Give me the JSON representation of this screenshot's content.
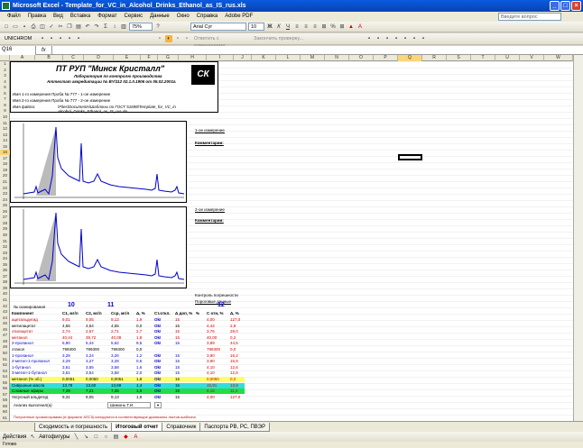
{
  "window": {
    "title": "Microsoft Excel - Template_for_VC_in_Alcohol_Drinks_Ethanol_as_IS_rus.xls"
  },
  "menu": [
    "Файл",
    "Правка",
    "Вид",
    "Вставка",
    "Формат",
    "Сервис",
    "Данные",
    "Окно",
    "Справка",
    "Adobe PDF"
  ],
  "question": {
    "placeholder": "Введите вопрос"
  },
  "toolbar": {
    "zoom": "75%",
    "font": "Arial Cyr",
    "size": "10",
    "unichrom": "UNICHROM",
    "reply": "Ответить с изменениями...",
    "end_review": "Закончить проверку..."
  },
  "formula": {
    "namebox": "Q16",
    "fx": "fx"
  },
  "columns": [
    "A",
    "B",
    "C",
    "D",
    "E",
    "F",
    "G",
    "H",
    "I",
    "J",
    "K",
    "L",
    "M",
    "N",
    "O",
    "P",
    "Q",
    "R",
    "S",
    "T",
    "U",
    "V",
    "W"
  ],
  "header": {
    "company": "ПТ РУП \"Минск Кристалл\"",
    "lab": "Лаборатория по контролю производства",
    "attest": "Аттестат аккредитации № BY/112 02.1.0.1906 от 05.02.2001г.",
    "logo": "СК"
  },
  "meta": {
    "row1": "Имя 1-го измерения Проба № 777 - 1-ое измерение",
    "row2": "Имя 2-го измерения Проба № 777 - 2-ое измерение",
    "file_label": "Имя файла:",
    "file_path": "\\Files\\Documents\\Шаблоны по ГОСТ 51698\\Template_for_VC_in",
    "file_path2": "Alcohol_Drinks_Ethanol_as_IS_rus.xls"
  },
  "chart1": {
    "side_title": "1-ое измерение",
    "comment": "Комментарии:"
  },
  "chart2": {
    "side_title": "2-ое измерение",
    "comment": "Комментарии:"
  },
  "control": {
    "title": "Контроль погрешности",
    "target": "Пороговые данные",
    "n_label": "№ сканирования",
    "n1": "10",
    "n2": "11",
    "cb": "12"
  },
  "table": {
    "headers": [
      "Компонент",
      "C1, мг/л",
      "C2, мг/л",
      "Cср, мг/л",
      "Δ, %",
      "Ст.откл.",
      "Δ доп, %",
      "%",
      "C отн, %",
      "Δ, %"
    ],
    "rows": [
      {
        "name": "ацетальдегид",
        "v": [
          "9,01",
          "9,05",
          "9,13",
          "1,9",
          "Ok!",
          "15",
          "4,00",
          "127,0"
        ],
        "color": "#c00"
      },
      {
        "name": "метилацетат",
        "v": [
          "4,55",
          "4,54",
          "4,55",
          "0,0",
          "Ok!",
          "15",
          "4,42",
          "2,9"
        ],
        "color": "#000"
      },
      {
        "name": "этилацетат",
        "v": [
          "2,74",
          "2,67",
          "2,71",
          "2,7",
          "Ok!",
          "15",
          "3,76",
          "29,0"
        ],
        "color": "#c00"
      },
      {
        "name": "метанол",
        "v": [
          "40,44",
          "39,72",
          "40,08",
          "1,8",
          "Ok!",
          "15",
          "40,00",
          "0,2"
        ],
        "color": "#c00"
      },
      {
        "name": "2-пропанол",
        "v": [
          "5,90",
          "5,44",
          "5,62",
          "9,5",
          "Ok!",
          "15",
          "3,89",
          "44,5"
        ],
        "color": "#00c"
      },
      {
        "name": "этанол",
        "v": [
          "799300",
          "799300",
          "799300",
          "0,0",
          "",
          "",
          "799300",
          "0,0"
        ],
        "color": "#000"
      },
      {
        "name": "1-пропанол",
        "v": [
          "3,28",
          "3,24",
          "3,26",
          "1,2",
          "Ok!",
          "15",
          "3,90",
          "16,2"
        ],
        "color": "#00c"
      },
      {
        "name": "2-метил-1-пропанол",
        "v": [
          "3,29",
          "3,27",
          "3,28",
          "0,6",
          "Ok!",
          "15",
          "3,90",
          "15,9"
        ],
        "color": "#00c"
      },
      {
        "name": "1-бутанол",
        "v": [
          "3,61",
          "3,55",
          "3,58",
          "1,6",
          "Ok!",
          "15",
          "4,10",
          "12,6"
        ],
        "color": "#00c"
      },
      {
        "name": "3-метил-1-бутанол",
        "v": [
          "3,61",
          "3,54",
          "3,58",
          "2,0",
          "Ok!",
          "15",
          "4,10",
          "12,6"
        ],
        "color": "#00c"
      },
      {
        "name": "метанол (% об.)",
        "v": [
          "0,0051",
          "0,0050",
          "0,0051",
          "1,8",
          "Ok!",
          "15",
          "0,0050",
          "0,2"
        ],
        "color": "#000",
        "bg": "#ffff66"
      },
      {
        "name": "Сивушные масла",
        "v": [
          "13,78",
          "13,60",
          "13,69",
          "1,4",
          "Ok!",
          "15",
          "15,91",
          "13,9"
        ],
        "color": "#000",
        "bg": "#33dddd"
      },
      {
        "name": "Сложные эфиры",
        "v": [
          "7,29",
          "7,21",
          "7,25",
          "1,0",
          "Ok!",
          "15",
          "8,18",
          "11,4"
        ],
        "color": "#000",
        "bg": "#22dd44"
      },
      {
        "name": "Уксусный альдегид",
        "v": [
          "9,31",
          "9,05",
          "9,13",
          "1,9",
          "Ok!",
          "15",
          "4,00",
          "127,0"
        ],
        "color": "#000"
      }
    ]
  },
  "footer": {
    "analysis": "Анализ выполнил(а)",
    "analyst": "Шимонь Т.И.",
    "note": "Полученные хроматограммы (в формате ASCII) копируются в соответствующие диапазоны листов шаблона"
  },
  "tabs": [
    "Сходимость и погрешность",
    "Итоговый отчет",
    "Справочник",
    "Паспорта РВ, РС, ПВЭР"
  ],
  "drawbar": {
    "actions": "Действия",
    "autoshapes": "Автофигуры"
  },
  "status": "Готово",
  "rowlabels": [
    "1",
    "2",
    "3",
    "4",
    "5",
    "6",
    "7",
    "8",
    "9",
    "10",
    "11",
    "12",
    "13",
    "14",
    "15",
    "16",
    "17",
    "18",
    "19",
    "20",
    "21",
    "22",
    "23",
    "24",
    "25",
    "26",
    "27",
    "28",
    "29",
    "30",
    "31",
    "32",
    "33",
    "34",
    "35",
    "36",
    "37",
    "38",
    "39",
    "40",
    "41",
    "42",
    "43",
    "44",
    "45",
    "46",
    "47",
    "48",
    "49",
    "50",
    "51",
    "52",
    "53",
    "54",
    "55",
    "56",
    "57",
    "58",
    "59",
    "60",
    "61"
  ]
}
